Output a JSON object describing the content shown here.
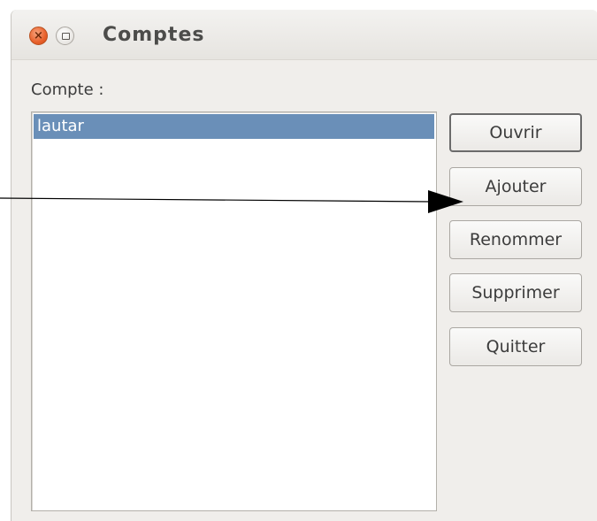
{
  "window": {
    "title": "Comptes"
  },
  "form": {
    "label": "Compte :"
  },
  "accounts": {
    "items": [
      "lautar"
    ],
    "selected_index": 0
  },
  "buttons": {
    "open": "Ouvrir",
    "add": "Ajouter",
    "rename": "Renommer",
    "delete": "Supprimer",
    "quit": "Quitter"
  },
  "colors": {
    "selection": "#6a8fb8",
    "close_button": "#e8602a",
    "window_bg": "#f0eeeb"
  },
  "icons": {
    "close": "close-icon",
    "maximize": "maximize-icon",
    "annotation": "arrow-icon"
  }
}
